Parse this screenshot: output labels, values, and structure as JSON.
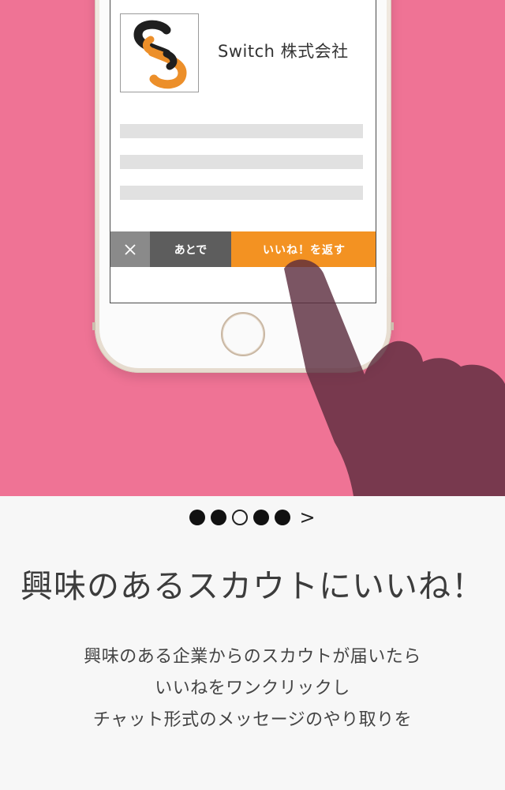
{
  "card": {
    "company_name": "Switch 株式会社",
    "logo_icon": "switch-chain-logo-icon",
    "placeholder_lines": 3
  },
  "actions": {
    "close_icon": "close-icon",
    "later_label": "あとで",
    "like_label": "いいね！を返す"
  },
  "pagination": {
    "dots": [
      "filled",
      "filled",
      "empty",
      "filled",
      "filled"
    ],
    "next_label": ">"
  },
  "headline": "興味のあるスカウトにいいね！",
  "description": [
    "興味のある企業からのスカウトが届いたら",
    "いいねをワンクリックし",
    "チャット形式のメッセージのやり取りを"
  ],
  "colors": {
    "background_pink": "#ef7395",
    "accent_orange": "#f39222",
    "logo_dark": "#1f1f1f",
    "hand": "#7a3a4e"
  }
}
